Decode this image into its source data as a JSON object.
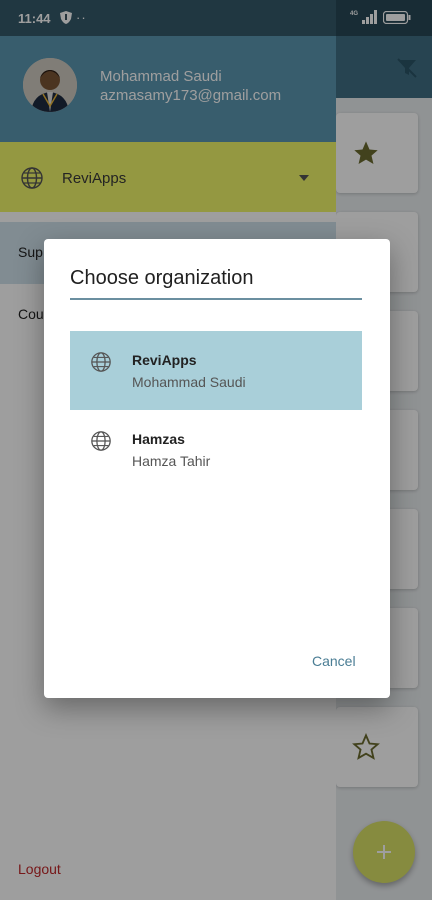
{
  "status_bar": {
    "time": "11:44",
    "dots": "··",
    "network": "4G",
    "icons": [
      "shield-icon",
      "signal-icon",
      "battery-icon"
    ]
  },
  "background": {
    "icons": [
      "filter-off-icon",
      "star-icon",
      "star-outline-icon",
      "add-icon"
    ]
  },
  "drawer": {
    "user": {
      "name": "Mohammad Saudi",
      "email": "azmasamy173@gmail.com"
    },
    "organization": {
      "selected": "ReviApps",
      "icon": "globe-icon"
    },
    "menu": [
      {
        "label": "Sup"
      },
      {
        "label": "Cou"
      }
    ],
    "logout_label": "Logout"
  },
  "dialog": {
    "title": "Choose organization",
    "options": [
      {
        "title": "ReviApps",
        "subtitle": "Mohammad Saudi",
        "selected": true
      },
      {
        "title": "Hamzas",
        "subtitle": "Hamza Tahir",
        "selected": false
      }
    ],
    "cancel_label": "Cancel"
  },
  "colors": {
    "primary": "#5b96b0",
    "accent_yellow": "#eff56a",
    "selected_option": "#a9cfd9",
    "logout": "#c0282a",
    "cancel": "#4a7d94"
  }
}
